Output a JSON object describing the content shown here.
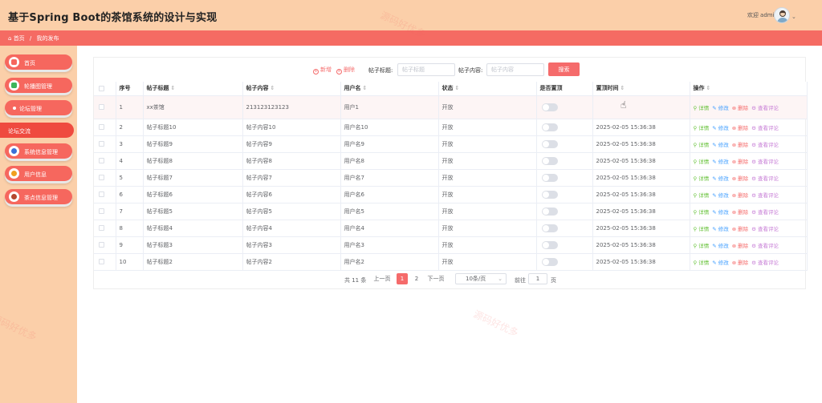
{
  "header": {
    "app_title": "基于Spring Boot的茶馆系统的设计与实现",
    "welcome": "欢迎 admin",
    "chevron": "⌄"
  },
  "breadcrumb": {
    "home": "首页",
    "separator": "/",
    "current": "我的发布"
  },
  "sidebar": {
    "items": [
      {
        "label": "首页"
      },
      {
        "label": "轮播图管理"
      },
      {
        "label": "论坛管理"
      },
      {
        "label": "论坛交流"
      },
      {
        "label": "系统信息管理"
      },
      {
        "label": "用户信息"
      },
      {
        "label": "茶点信息管理"
      }
    ]
  },
  "toolbar": {
    "add_label": "新增",
    "delete_label": "删除",
    "title_label": "帖子标题:",
    "title_placeholder": "帖子标题",
    "content_label": "帖子内容:",
    "content_placeholder": "帖子内容",
    "search_label": "搜索"
  },
  "table": {
    "columns": [
      "序号",
      "帖子标题",
      "帖子内容",
      "用户名",
      "状态",
      "是否置顶",
      "置顶时间",
      "操作"
    ],
    "sort_glyph": "⇕",
    "actions": {
      "detail": "详情",
      "edit": "修改",
      "delete": "删除",
      "comments": "查看评论"
    },
    "rows": [
      {
        "no": "1",
        "title": "xx茶馆",
        "content": "213123123123",
        "user": "用户1",
        "status": "开放",
        "pinned": false,
        "pin_time": ""
      },
      {
        "no": "2",
        "title": "帖子标题10",
        "content": "帖子内容10",
        "user": "用户名10",
        "status": "开放",
        "pinned": false,
        "pin_time": "2025-02-05 15:36:38"
      },
      {
        "no": "3",
        "title": "帖子标题9",
        "content": "帖子内容9",
        "user": "用户名9",
        "status": "开放",
        "pinned": false,
        "pin_time": "2025-02-05 15:36:38"
      },
      {
        "no": "4",
        "title": "帖子标题8",
        "content": "帖子内容8",
        "user": "用户名8",
        "status": "开放",
        "pinned": false,
        "pin_time": "2025-02-05 15:36:38"
      },
      {
        "no": "5",
        "title": "帖子标题7",
        "content": "帖子内容7",
        "user": "用户名7",
        "status": "开放",
        "pinned": false,
        "pin_time": "2025-02-05 15:36:38"
      },
      {
        "no": "6",
        "title": "帖子标题6",
        "content": "帖子内容6",
        "user": "用户名6",
        "status": "开放",
        "pinned": false,
        "pin_time": "2025-02-05 15:36:38"
      },
      {
        "no": "7",
        "title": "帖子标题5",
        "content": "帖子内容5",
        "user": "用户名5",
        "status": "开放",
        "pinned": false,
        "pin_time": "2025-02-05 15:36:38"
      },
      {
        "no": "8",
        "title": "帖子标题4",
        "content": "帖子内容4",
        "user": "用户名4",
        "status": "开放",
        "pinned": false,
        "pin_time": "2025-02-05 15:36:38"
      },
      {
        "no": "9",
        "title": "帖子标题3",
        "content": "帖子内容3",
        "user": "用户名3",
        "status": "开放",
        "pinned": false,
        "pin_time": "2025-02-05 15:36:38"
      },
      {
        "no": "10",
        "title": "帖子标题2",
        "content": "帖子内容2",
        "user": "用户名2",
        "status": "开放",
        "pinned": false,
        "pin_time": "2025-02-05 15:36:38"
      }
    ]
  },
  "pagination": {
    "total_text": "共 11 条",
    "prev_label": "上一页",
    "pages": [
      "1",
      "2"
    ],
    "current_page": "1",
    "next_label": "下一页",
    "page_size": "10条/页",
    "goto_label": "前往",
    "goto_value": "1",
    "page_suffix": "页"
  },
  "watermark": "源码好优多",
  "colors": {
    "accent": "#f56b63",
    "header_bg": "#fbcfa9",
    "sidebar_active": "#ef4a3f"
  },
  "icons": [
    "home-icon",
    "image-icon",
    "chat-icon",
    "settings-icon",
    "user-icon",
    "tea-icon",
    "search-icon",
    "edit-icon",
    "delete-icon",
    "comment-icon"
  ]
}
